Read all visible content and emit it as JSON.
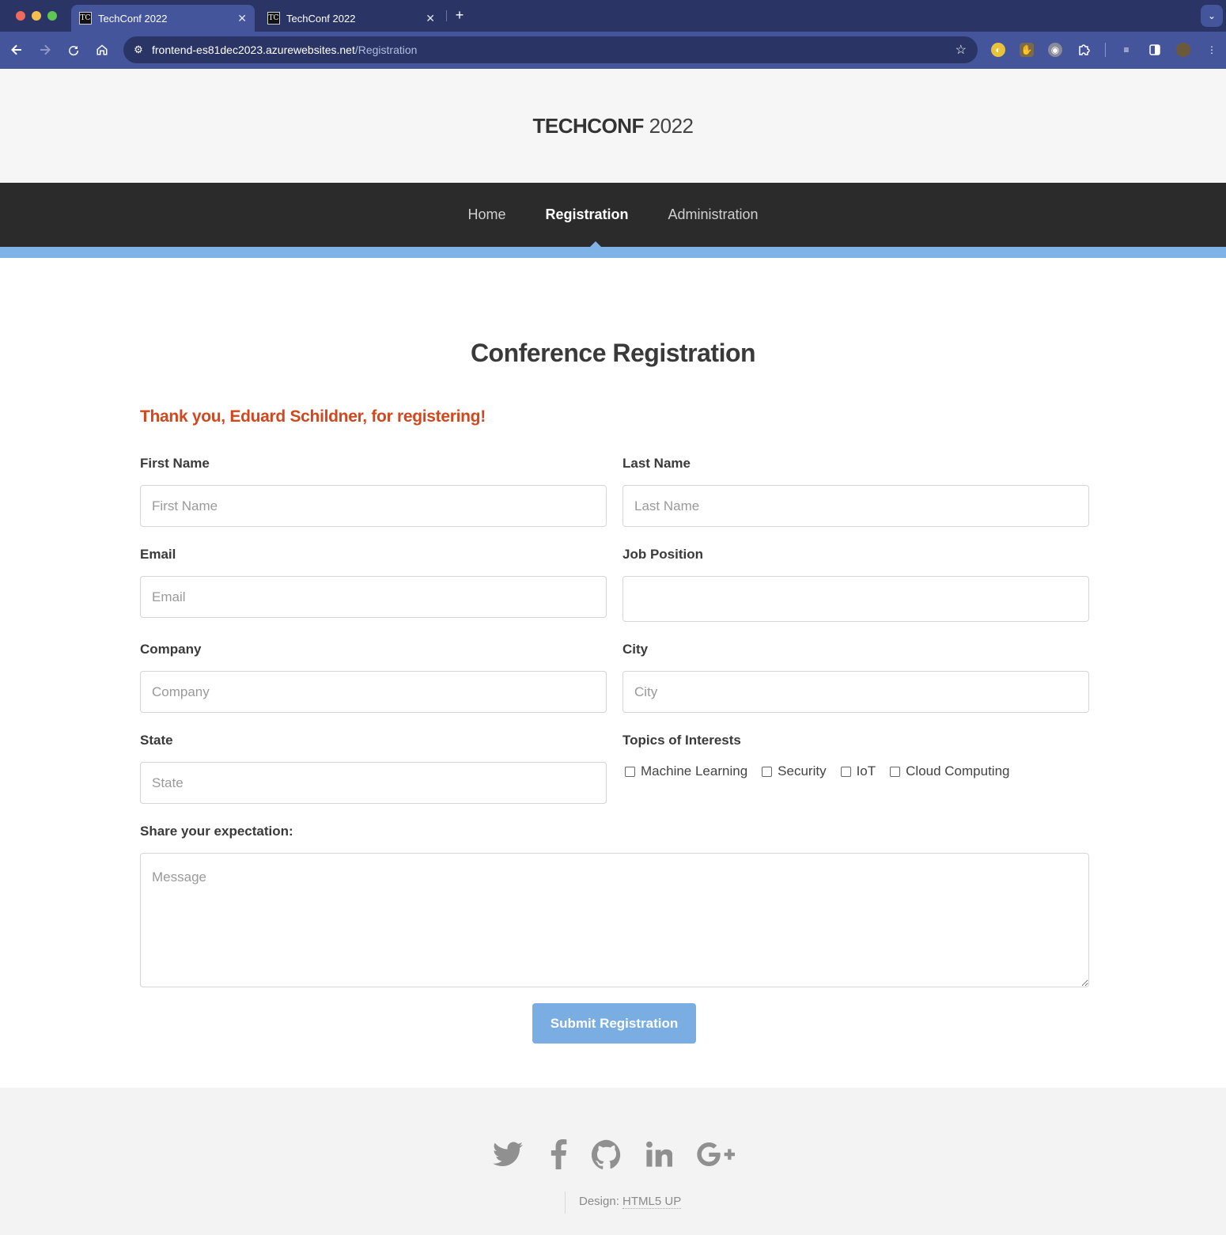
{
  "browser": {
    "tabs": [
      {
        "favicon": "TC",
        "title": "TechConf 2022",
        "active": true
      },
      {
        "favicon": "TC",
        "title": "TechConf 2022",
        "active": false
      }
    ],
    "url_host": "frontend-es81dec2023.azurewebsites.net",
    "url_path": "/Registration",
    "theme_color": "#44559b",
    "tabbar_color": "#2a3566"
  },
  "header": {
    "title_bold": "TECHCONF",
    "title_light": "2022"
  },
  "nav": {
    "items": [
      {
        "label": "Home",
        "active": false
      },
      {
        "label": "Registration",
        "active": true
      },
      {
        "label": "Administration",
        "active": false
      }
    ],
    "accent_color": "#7fb3e8"
  },
  "main": {
    "heading": "Conference Registration",
    "success_message": "Thank you, Eduard Schildner, for registering!",
    "success_color": "#d4471d",
    "form": {
      "first_name": {
        "label": "First Name",
        "placeholder": "First Name",
        "value": ""
      },
      "last_name": {
        "label": "Last Name",
        "placeholder": "Last Name",
        "value": ""
      },
      "email": {
        "label": "Email",
        "placeholder": "Email",
        "value": ""
      },
      "job_position": {
        "label": "Job Position",
        "value": ""
      },
      "company": {
        "label": "Company",
        "placeholder": "Company",
        "value": ""
      },
      "city": {
        "label": "City",
        "placeholder": "City",
        "value": ""
      },
      "state": {
        "label": "State",
        "placeholder": "State",
        "value": ""
      },
      "topics": {
        "label": "Topics of Interests",
        "options": [
          {
            "label": "Machine Learning",
            "checked": false
          },
          {
            "label": "Security",
            "checked": false
          },
          {
            "label": "IoT",
            "checked": false
          },
          {
            "label": "Cloud Computing",
            "checked": false
          }
        ]
      },
      "message": {
        "label": "Share your expectation:",
        "placeholder": "Message",
        "value": ""
      },
      "submit_label": "Submit Registration",
      "submit_color": "#7aaee2"
    }
  },
  "footer": {
    "social_icons": [
      "twitter-icon",
      "facebook-icon",
      "github-icon",
      "linkedin-icon",
      "google-plus-icon"
    ],
    "credit_prefix": "Design:",
    "credit_link": "HTML5 UP"
  }
}
